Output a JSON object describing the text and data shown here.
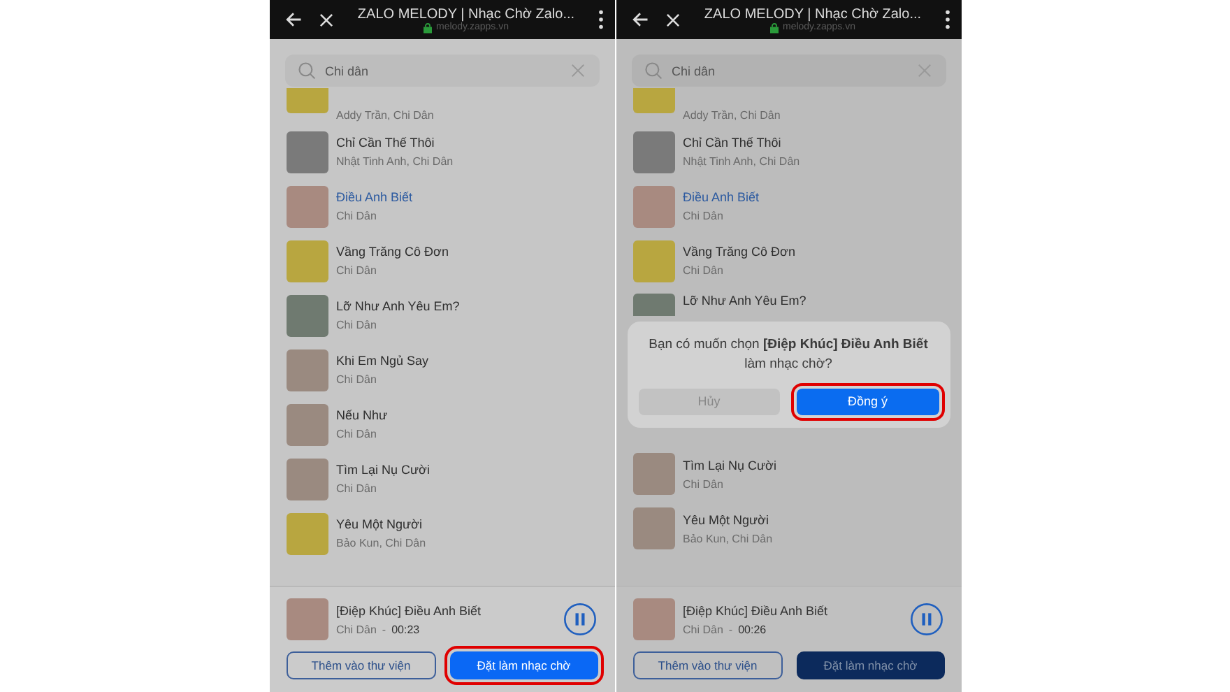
{
  "screens": [
    {
      "browser": {
        "title": "ZALO MELODY | Nhạc Chờ Zalo...",
        "url": "melody.zapps.vn"
      },
      "search": {
        "value": "Chi dân"
      },
      "songs": [
        {
          "kind": "partial",
          "artist": "Addy Trần, Chi Dân",
          "selected": false
        },
        {
          "kind": "song",
          "title": "Chỉ Cần Thế Thôi",
          "artist": "Nhật Tinh Anh, Chi Dân",
          "selected": false
        },
        {
          "kind": "song",
          "title": "Điều Anh Biết",
          "artist": "Chi Dân",
          "selected": true
        },
        {
          "kind": "song",
          "title": "Vầng Trăng Cô Đơn",
          "artist": "Chi Dân",
          "selected": false
        },
        {
          "kind": "song",
          "title": "Lỡ Như Anh Yêu Em?",
          "artist": "Chi Dân",
          "selected": false
        },
        {
          "kind": "song",
          "title": "Khi Em Ngủ Say",
          "artist": "Chi Dân",
          "selected": false
        },
        {
          "kind": "song",
          "title": "Nếu Như",
          "artist": "Chi Dân",
          "selected": false
        },
        {
          "kind": "song",
          "title": "Tìm Lại Nụ Cười",
          "artist": "Chi Dân",
          "selected": false
        },
        {
          "kind": "song",
          "title": "Yêu Một Người",
          "artist": "Bảo Kun, Chi Dân",
          "selected": false
        }
      ],
      "player": {
        "title": "[Điệp Khúc] Điều Anh Biết",
        "artist": "Chi Dân",
        "separator": "-",
        "time": "00:23"
      },
      "buttons": [
        {
          "label": "Thêm vào thư viện",
          "kind": "secondary",
          "highlighted": false
        },
        {
          "label": "Đặt làm nhạc chờ",
          "kind": "primary",
          "highlighted": true
        }
      ]
    },
    {
      "browser": {
        "title": "ZALO MELODY | Nhạc Chờ Zalo...",
        "url": "melody.zapps.vn"
      },
      "search": {
        "value": "Chi dân"
      },
      "songs": [
        {
          "kind": "partial",
          "artist": "Addy Trần, Chi Dân",
          "selected": false
        },
        {
          "kind": "song",
          "title": "Chỉ Cần Thế Thôi",
          "artist": "Nhật Tinh Anh, Chi Dân",
          "selected": false
        },
        {
          "kind": "song",
          "title": "Điều Anh Biết",
          "artist": "Chi Dân",
          "selected": true
        },
        {
          "kind": "song",
          "title": "Vầng Trăng Cô Đơn",
          "artist": "Chi Dân",
          "selected": false
        },
        {
          "kind": "covered",
          "title": "Lỡ Như Anh Yêu Em?",
          "selected": false
        },
        {
          "kind": "dialog"
        },
        {
          "kind": "song",
          "title": "Tìm Lại Nụ Cười",
          "artist": "Chi Dân",
          "selected": false
        },
        {
          "kind": "song",
          "title": "Yêu Một Người",
          "artist": "Bảo Kun, Chi Dân",
          "selected": false
        }
      ],
      "dialog": {
        "message": "Bạn có muốn chọn **[Điệp Khúc] Điều Anh Biết** làm nhạc chờ?",
        "buttons": [
          {
            "label": "Hủy",
            "kind": "cancel",
            "highlighted": false
          },
          {
            "label": "Đồng ý",
            "kind": "confirm",
            "highlighted": true
          }
        ]
      },
      "player": {
        "title": "[Điệp Khúc] Điều Anh Biết",
        "artist": "Chi Dân",
        "separator": "-",
        "time": "00:26"
      },
      "buttons": [
        {
          "label": "Thêm vào thư viện",
          "kind": "secondary",
          "highlighted": false
        },
        {
          "label": "Đặt làm nhạc chờ",
          "kind": "primary",
          "highlighted": false
        }
      ]
    }
  ]
}
